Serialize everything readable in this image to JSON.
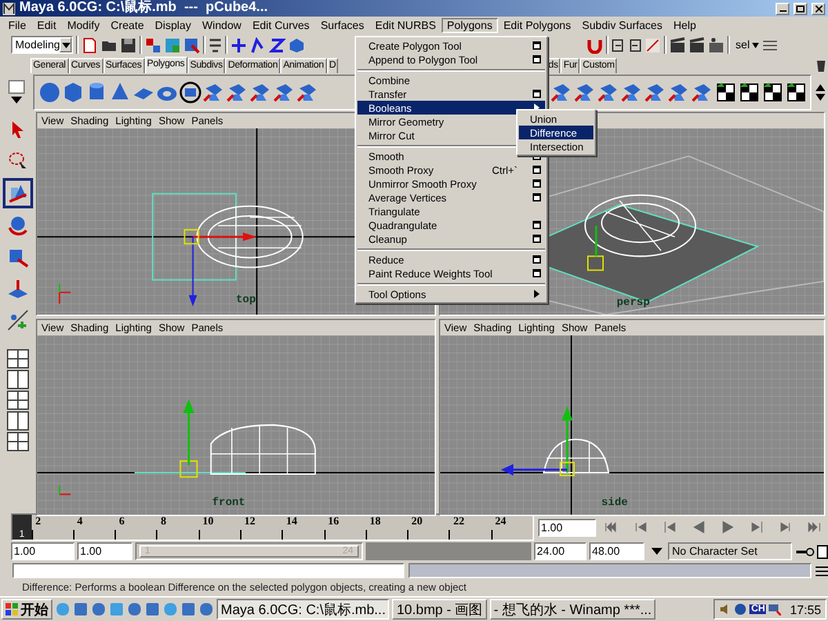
{
  "window": {
    "title": "Maya 6.0CG: C:\\鼠标.mb  ---  pCube4..."
  },
  "menu_bar": [
    {
      "label": "File",
      "selected": false
    },
    {
      "label": "Edit",
      "selected": false
    },
    {
      "label": "Modify",
      "selected": false
    },
    {
      "label": "Create",
      "selected": false
    },
    {
      "label": "Display",
      "selected": false
    },
    {
      "label": "Window",
      "selected": false
    },
    {
      "label": "Edit Curves",
      "selected": false
    },
    {
      "label": "Surfaces",
      "selected": false
    },
    {
      "label": "Edit NURBS",
      "selected": false
    },
    {
      "label": "Polygons",
      "selected": true
    },
    {
      "label": "Edit Polygons",
      "selected": false
    },
    {
      "label": "Subdiv Surfaces",
      "selected": false
    },
    {
      "label": "Help",
      "selected": false
    }
  ],
  "toolbar": {
    "mode": "Modeling",
    "selection_label": "sel"
  },
  "shelf_tabs": [
    {
      "label": "General",
      "selected": false
    },
    {
      "label": "Curves",
      "selected": false
    },
    {
      "label": "Surfaces",
      "selected": false
    },
    {
      "label": "Polygons",
      "selected": true
    },
    {
      "label": "Subdivs",
      "selected": false
    },
    {
      "label": "Deformation",
      "selected": false
    },
    {
      "label": "Animation",
      "selected": false
    },
    {
      "label": "D",
      "selected": false
    },
    {
      "label": "ds",
      "selected": false
    },
    {
      "label": "Fur",
      "selected": false
    },
    {
      "label": "Custom",
      "selected": false
    }
  ],
  "toolbox": [
    {
      "kind": "select",
      "selected": false
    },
    {
      "kind": "lasso",
      "selected": false
    },
    {
      "kind": "move",
      "selected": true
    },
    {
      "kind": "rotate",
      "selected": false
    },
    {
      "kind": "scale",
      "selected": false
    },
    {
      "kind": "manipulator",
      "selected": false
    },
    {
      "kind": "last",
      "selected": false
    }
  ],
  "viewports": [
    {
      "kind": "top",
      "label": "top",
      "menu": [
        "View",
        "Shading",
        "Lighting",
        "Show",
        "Panels"
      ]
    },
    {
      "kind": "persp",
      "label": "persp"
    },
    {
      "kind": "front",
      "label": "front",
      "menu": [
        "View",
        "Shading",
        "Lighting",
        "Show",
        "Panels"
      ]
    },
    {
      "kind": "side",
      "label": "side",
      "menu": [
        "View",
        "Shading",
        "Lighting",
        "Show",
        "Panels"
      ]
    }
  ],
  "polygons_menu": [
    {
      "kind": "item",
      "label": "Create Polygon Tool",
      "option_box": true,
      "submenu": false,
      "selected": false
    },
    {
      "kind": "item",
      "label": "Append to Polygon Tool",
      "option_box": true,
      "submenu": false,
      "selected": false
    },
    {
      "kind": "separator"
    },
    {
      "kind": "item",
      "label": "Combine",
      "option_box": false,
      "submenu": false,
      "selected": false
    },
    {
      "kind": "item",
      "label": "Transfer",
      "option_box": true,
      "submenu": false,
      "selected": false
    },
    {
      "kind": "item",
      "label": "Booleans",
      "option_box": false,
      "submenu": true,
      "selected": true
    },
    {
      "kind": "item",
      "label": "Mirror Geometry",
      "selected": false
    },
    {
      "kind": "item",
      "label": "Mirror Cut",
      "selected": false
    },
    {
      "kind": "separator"
    },
    {
      "kind": "item",
      "label": "Smooth",
      "option_box": true,
      "submenu": false,
      "selected": false
    },
    {
      "kind": "item",
      "label": "Smooth Proxy",
      "shortcut": "Ctrl+`",
      "option_box": true,
      "submenu": false,
      "selected": false
    },
    {
      "kind": "item",
      "label": "Unmirror Smooth Proxy",
      "option_box": true,
      "submenu": false,
      "selected": false
    },
    {
      "kind": "item",
      "label": "Average Vertices",
      "option_box": true,
      "submenu": false,
      "selected": false
    },
    {
      "kind": "item",
      "label": "Triangulate",
      "option_box": false,
      "submenu": false,
      "selected": false
    },
    {
      "kind": "item",
      "label": "Quadrangulate",
      "option_box": true,
      "submenu": false,
      "selected": false
    },
    {
      "kind": "item",
      "label": "Cleanup",
      "option_box": true,
      "submenu": false,
      "selected": false
    },
    {
      "kind": "separator"
    },
    {
      "kind": "item",
      "label": "Reduce",
      "option_box": true,
      "submenu": false,
      "selected": false
    },
    {
      "kind": "item",
      "label": "Paint Reduce Weights Tool",
      "option_box": true,
      "submenu": false,
      "selected": false
    },
    {
      "kind": "separator"
    },
    {
      "kind": "item",
      "label": "Tool Options",
      "option_box": false,
      "submenu": true,
      "selected": false
    }
  ],
  "booleans_submenu": [
    {
      "label": "Union",
      "selected": false
    },
    {
      "label": "Difference",
      "selected": true
    },
    {
      "label": "Intersection",
      "selected": false
    }
  ],
  "timeline": {
    "current_frame": "1",
    "labels": [
      "2",
      "4",
      "6",
      "8",
      "10",
      "12",
      "14",
      "16",
      "18",
      "20",
      "22",
      "24"
    ],
    "frame_field": "1.00"
  },
  "range": {
    "start": "1.00",
    "playback_start": "1.00",
    "slider_start": "1",
    "slider_end": "24",
    "playback_end": "24.00",
    "end": "48.00",
    "character_set": "No Character Set"
  },
  "help_line": "Difference: Performs a boolean Difference on the selected polygon objects, creating a new object",
  "taskbar": {
    "start": "开始",
    "tasks": [
      {
        "label": "Maya 6.0CG: C:\\鼠标.mb...",
        "selected": true
      },
      {
        "label": "10.bmp - 画图",
        "selected": false
      },
      {
        "label": "- 想飞的水 - Winamp ***...",
        "selected": false
      }
    ],
    "input_indicator": "CH",
    "clock": "17:55"
  }
}
